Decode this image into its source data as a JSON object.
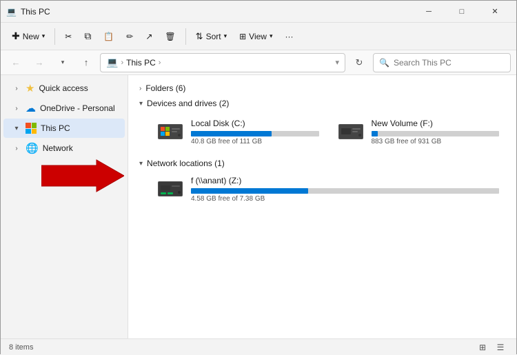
{
  "window": {
    "title": "This PC",
    "icon": "💻"
  },
  "titlebar": {
    "minimize": "─",
    "maximize": "□",
    "close": "✕"
  },
  "toolbar": {
    "new_label": "New",
    "cut_icon": "✂",
    "copy_icon": "⧉",
    "paste_icon": "📋",
    "rename_icon": "✏",
    "share_icon": "↗",
    "delete_icon": "🗑",
    "sort_label": "Sort",
    "view_label": "View",
    "more_icon": "···"
  },
  "addressbar": {
    "path": "This PC",
    "search_placeholder": "Search This PC"
  },
  "sidebar": {
    "items": [
      {
        "id": "quick-access",
        "label": "Quick access",
        "icon": "★",
        "expanded": false
      },
      {
        "id": "onedrive",
        "label": "OneDrive - Personal",
        "icon": "☁",
        "expanded": false
      },
      {
        "id": "this-pc",
        "label": "This PC",
        "icon": "pc",
        "active": true,
        "expanded": true
      },
      {
        "id": "network",
        "label": "Network",
        "icon": "🌐",
        "expanded": false
      }
    ]
  },
  "content": {
    "folders_section": {
      "label": "Folders (6)",
      "expanded": false
    },
    "devices_section": {
      "label": "Devices and drives (2)",
      "expanded": true,
      "drives": [
        {
          "id": "local-c",
          "name": "Local Disk (C:)",
          "free": "40.8 GB free of 111 GB",
          "used_pct": 63,
          "near_full": false
        },
        {
          "id": "new-vol-f",
          "name": "New Volume (F:)",
          "free": "883 GB free of 931 GB",
          "used_pct": 5,
          "near_full": false
        }
      ]
    },
    "network_section": {
      "label": "Network locations (1)",
      "expanded": true,
      "locations": [
        {
          "id": "network-z",
          "name": "f (\\\\anant) (Z:)",
          "free": "4.58 GB free of 7.38 GB",
          "used_pct": 38,
          "near_full": false
        }
      ]
    }
  },
  "statusbar": {
    "items_count": "8 items"
  }
}
